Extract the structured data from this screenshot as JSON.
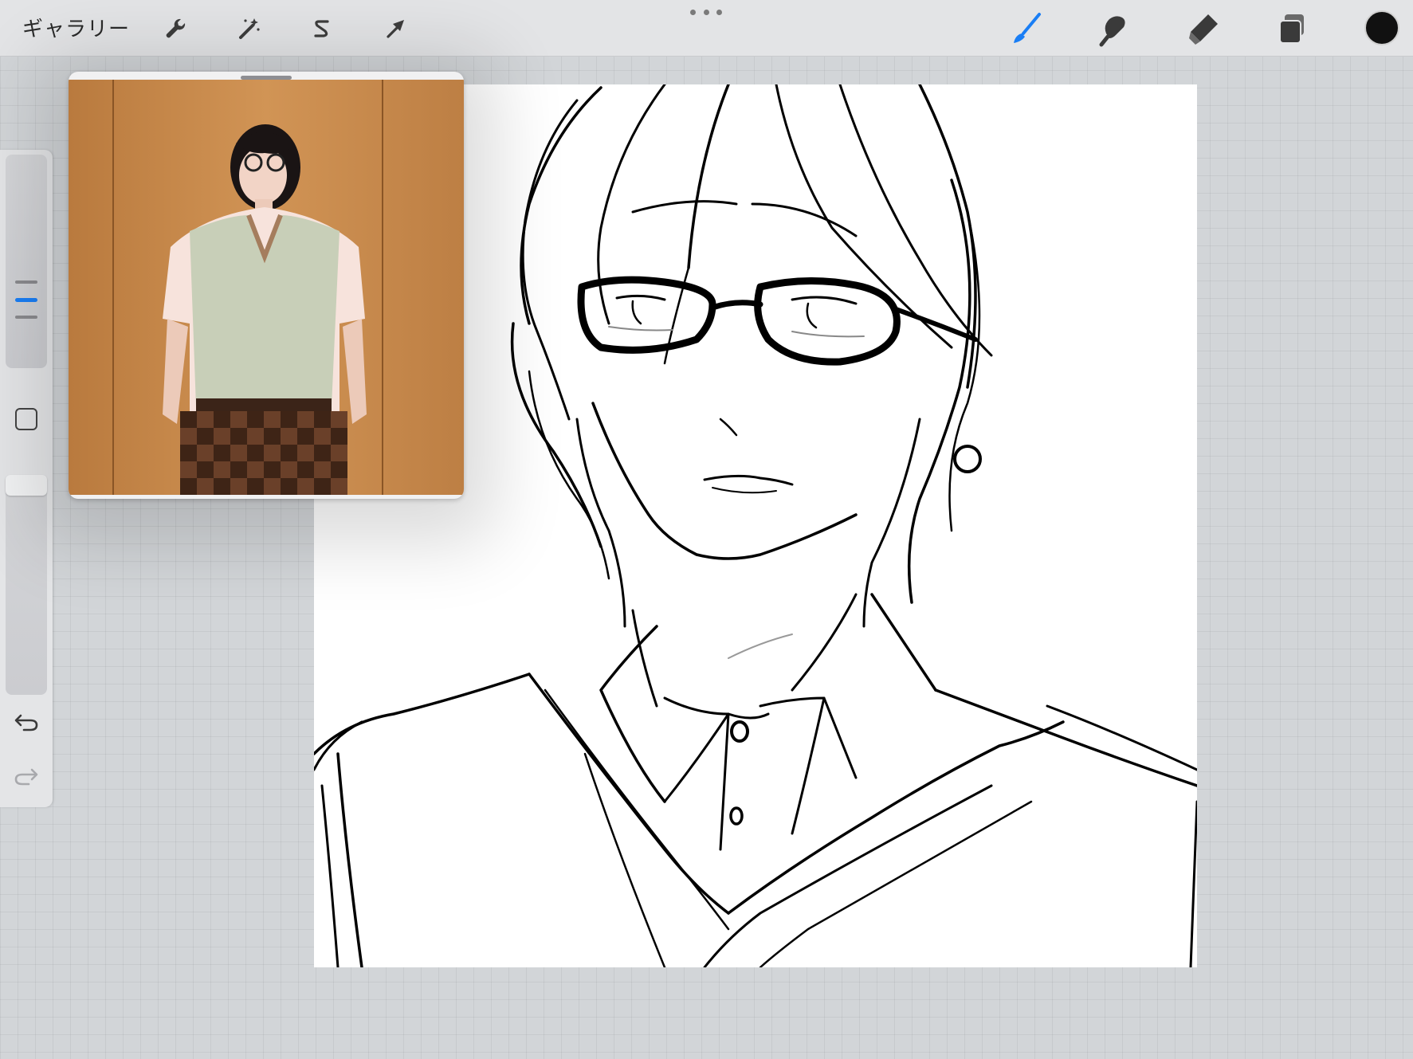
{
  "toolbar": {
    "gallery_label": "ギャラリー",
    "left_tools": [
      {
        "name": "actions",
        "icon": "wrench-icon"
      },
      {
        "name": "adjustments",
        "icon": "magic-wand-icon"
      },
      {
        "name": "selection",
        "icon": "selection-s-icon"
      },
      {
        "name": "transform",
        "icon": "arrow-cursor-icon"
      }
    ],
    "right_tools": [
      {
        "name": "brush",
        "icon": "brush-icon",
        "active": true
      },
      {
        "name": "smudge",
        "icon": "smudge-finger-icon",
        "active": false
      },
      {
        "name": "eraser",
        "icon": "eraser-icon",
        "active": false
      },
      {
        "name": "layers",
        "icon": "layers-icon",
        "active": false
      }
    ],
    "current_color": "#111111",
    "active_color": "#1a7ef5"
  },
  "sidebar": {
    "brush_size_icon": "size-slider",
    "modify_button_icon": "square-icon",
    "opacity_icon": "opacity-slider",
    "undo_icon": "undo-arrow-icon",
    "redo_icon": "redo-arrow-icon"
  },
  "reference": {
    "window": "reference-photo-window",
    "handle_icon": "drag-handle-icon"
  },
  "canvas": {
    "background": "#ffffff",
    "stroke_color": "#000000"
  }
}
